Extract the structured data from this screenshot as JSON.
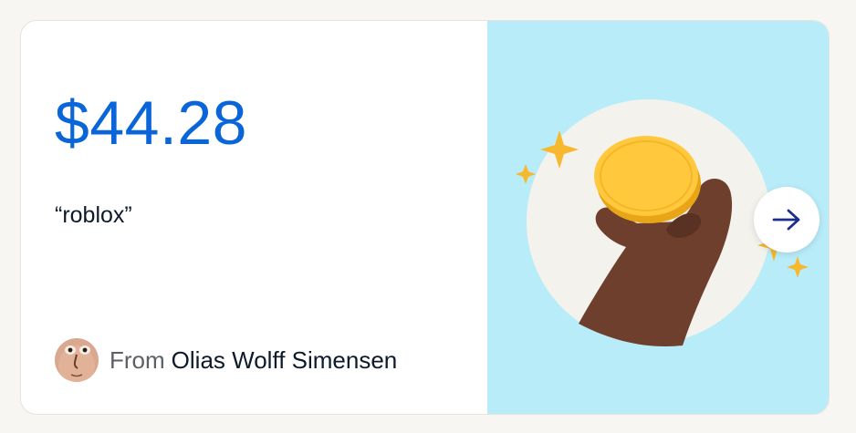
{
  "gift": {
    "amount": "$44.28",
    "note": "“roblox”",
    "from_prefix": "From",
    "sender_name": "Olias Wolff Simensen"
  },
  "icons": {
    "next": "arrow-right-icon",
    "avatar": "sender-avatar",
    "illustration": "hand-holding-coin-illustration"
  },
  "colors": {
    "amount": "#0a66d8",
    "illustration_bg": "#b9ecf9",
    "coin": "#ffc83d",
    "hand": "#6e3f2c",
    "arrow": "#1a2f8a"
  }
}
